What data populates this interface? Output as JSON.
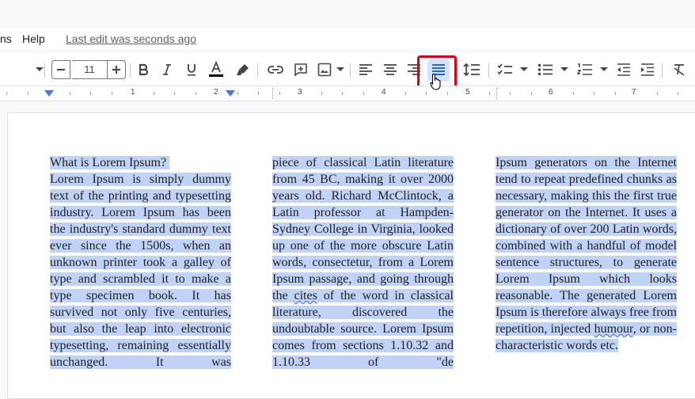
{
  "menu": {
    "items": [
      "ns",
      "Help"
    ],
    "last_edit": "Last edit was seconds ago"
  },
  "toolbar": {
    "font_size": "11"
  },
  "ruler": {
    "numbers": [
      "1",
      "2",
      "3",
      "4",
      "5",
      "6",
      "7"
    ]
  },
  "columns": [
    {
      "heading": "What is Lorem Ipsum?",
      "text": "Lorem Ipsum is simply dummy text of the printing and typesetting industry. Lorem Ipsum has been the industry's standard dummy text ever since the 1500s, when an unknown printer took a galley of type and scrambled it to make a type specimen book. It has survived not only five centuries, but also the leap into electronic typesetting, remaining essentially unchanged. It was"
    },
    {
      "text_a": "piece of classical Latin literature from 45 BC, making it over 2000 years old. Richard McClintock, a Latin professor at Hampden-Sydney College in Virginia, looked up one of the more obscure Latin words, consectetur, from a Lorem Ipsum passage, and going through the ",
      "cites": "cites",
      "text_b": " of the word in classical literature, discovered the undoubtable source. Lorem Ipsum comes from sections 1.10.32 and 1.10.33 of \"de"
    },
    {
      "text_a": "Ipsum generators on the Internet tend to repeat predefined chunks as necessary, making this the first true generator on the Internet. It uses a dictionary of over 200 Latin words, combined with a handful of model sentence structures, to generate Lorem Ipsum which looks reasonable. The generated Lorem Ipsum is therefore always free from repetition, injected ",
      "humour": "humour",
      "text_b": ", or non-characteristic words etc."
    }
  ],
  "colors": {
    "selection": "#c0d3f7",
    "highlight_frame": "#e3000f",
    "ruler_marker": "#4a76dc"
  }
}
